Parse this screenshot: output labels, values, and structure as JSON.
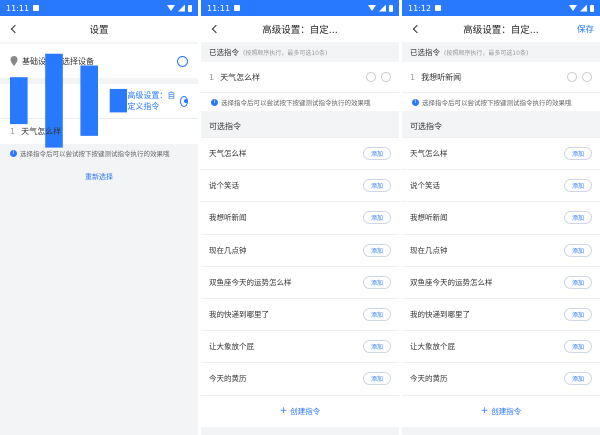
{
  "screens": [
    {
      "status_time": "11:11",
      "title": "设置",
      "basic": {
        "label": "基础设置：选择设备"
      },
      "advanced": {
        "label": "高级设置：自定义指令",
        "commands": [
          {
            "num": "1",
            "text": "天气怎么样"
          }
        ],
        "tip": "选择指令后可以尝试按下按键测试指令执行的效果哦",
        "reselect": "重新选择"
      }
    },
    {
      "status_time": "11:11",
      "title": "高级设置：自定...",
      "selected_title": "已选指令",
      "selected_hint": "(按照顺序执行，最多可选10条)",
      "selected": [
        {
          "num": "1",
          "text": "天气怎么样"
        }
      ],
      "tip": "选择指令后可以尝试按下按键测试指令执行的效果哦",
      "optional_title": "可选指令",
      "options": [
        "天气怎么样",
        "说个笑话",
        "我想听新闻",
        "现在几点钟",
        "双鱼座今天的运势怎么样",
        "我的快递到哪里了",
        "让大象放个屁",
        "今天的黄历"
      ],
      "add_label": "添加",
      "create_label": "创建指令"
    },
    {
      "status_time": "11:12",
      "title": "高级设置：自定...",
      "save_label": "保存",
      "selected_title": "已选指令",
      "selected_hint": "(按照顺序执行，最多可选10条)",
      "selected": [
        {
          "num": "1",
          "text": "我想听新闻"
        }
      ],
      "tip": "选择指令后可以尝试按下按键测试指令执行的效果哦",
      "optional_title": "可选指令",
      "options": [
        "天气怎么样",
        "说个笑话",
        "我想听新闻",
        "现在几点钟",
        "双鱼座今天的运势怎么样",
        "我的快递到哪里了",
        "让大象放个屁",
        "今天的黄历"
      ],
      "add_label": "添加",
      "create_label": "创建指令"
    }
  ],
  "colors": {
    "accent": "#2979ff",
    "background": "#f3f4f6"
  }
}
